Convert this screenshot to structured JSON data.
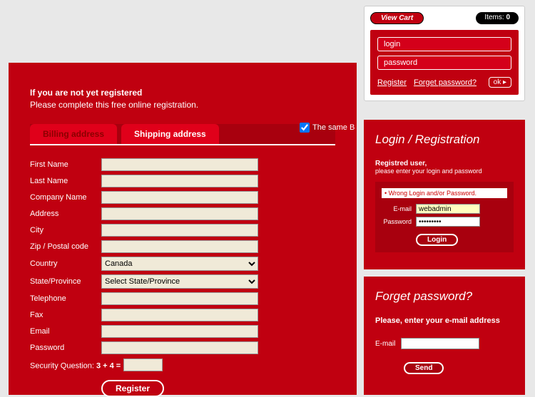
{
  "header": {
    "view_cart": "View Cart",
    "items_label": "Items:",
    "items_count": "0"
  },
  "login_box": {
    "login_ph": "login",
    "pass_ph": "password",
    "register": "Register",
    "forget": "Forget password?",
    "ok": "ok ▸"
  },
  "main": {
    "title": "If you are not yet registered",
    "subtitle": "Please complete this free online registration.",
    "tab_billing": "Billing address",
    "tab_shipping": "Shipping address",
    "same": "The same B",
    "labels": {
      "first": "First Name",
      "last": "Last Name",
      "company": "Company Name",
      "address": "Address",
      "city": "City",
      "zip": "Zip / Postal code",
      "country": "Country",
      "state": "State/Province",
      "tel": "Telephone",
      "fax": "Fax",
      "email": "Email",
      "pass": "Password"
    },
    "country_val": "Canada",
    "state_val": "Select State/Province",
    "sec_q": "Security Question:",
    "sec_eq": "3 + 4 =",
    "register_btn": "Register"
  },
  "panel_login": {
    "title": "Login / Registration",
    "t1": "Registred user,",
    "t2": "please enter your login and password",
    "error": "Wrong Login and/or Password.",
    "email_lbl": "E-mail",
    "email_val": "webadmin",
    "pass_lbl": "Password",
    "pass_val": "•••••••••",
    "btn": "Login"
  },
  "panel_forget": {
    "title": "Forget password?",
    "msg": "Please, enter your e-mail address",
    "email_lbl": "E-mail",
    "btn": "Send"
  }
}
